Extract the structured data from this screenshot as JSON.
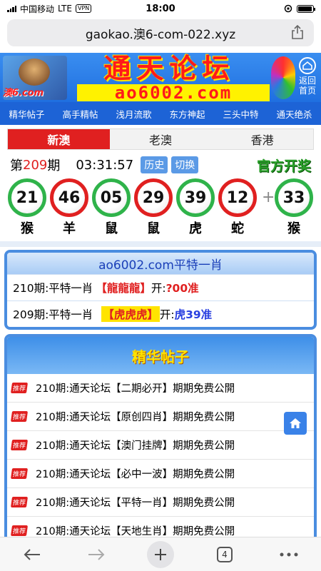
{
  "status": {
    "carrier": "中国移动",
    "network": "LTE",
    "vpn": "VPN",
    "time": "18:00",
    "battery_level": 0.95
  },
  "url": "gaokao.澳6-com-022.xyz",
  "banner": {
    "left_domain": "澳6.com",
    "title": "通天论坛",
    "subtitle": "ao6002.com",
    "back_label": "返回首页"
  },
  "nav": [
    "精华帖子",
    "高手精帖",
    "浅月流歌",
    "东方神起",
    "三头中特",
    "通天绝杀"
  ],
  "tabs": [
    {
      "label": "新澳",
      "active": true
    },
    {
      "label": "老澳",
      "active": false
    },
    {
      "label": "香港",
      "active": false
    }
  ],
  "draw": {
    "prefix": "第",
    "issue": "209",
    "suffix": "期",
    "countdown": "03:31:57",
    "history_label": "历史",
    "switch_label": "切换",
    "official_label": "官方开奖",
    "balls": [
      {
        "num": "21",
        "zodiac": "猴",
        "color": "green"
      },
      {
        "num": "46",
        "zodiac": "羊",
        "color": "red"
      },
      {
        "num": "05",
        "zodiac": "鼠",
        "color": "green"
      },
      {
        "num": "29",
        "zodiac": "鼠",
        "color": "red"
      },
      {
        "num": "39",
        "zodiac": "虎",
        "color": "green"
      },
      {
        "num": "12",
        "zodiac": "蛇",
        "color": "red"
      }
    ],
    "plus": "+",
    "special": {
      "num": "33",
      "zodiac": "猴",
      "color": "green"
    }
  },
  "special_box": {
    "title": "ao6002.com平特一肖",
    "rows": [
      {
        "prefix": "210期:平特一肖",
        "pick": "【龍龍龍】",
        "open_label": "开:",
        "result": "?00准",
        "highlight": false
      },
      {
        "prefix": "209期:平特一肖",
        "pick": "【虎虎虎】",
        "open_label": "开:",
        "result": "虎39准",
        "highlight": true
      }
    ]
  },
  "featured": {
    "title": "精华帖子",
    "badge": "推荐",
    "posts": [
      "210期:通天论坛【二期必开】期期免费公開",
      "210期:通天论坛【原创四肖】期期免费公開",
      "210期:通天论坛【澳门挂牌】期期免费公開",
      "210期:通天论坛【必中一波】期期免费公開",
      "210期:通天论坛【平特一肖】期期免费公開",
      "210期:通天论坛【天地生肖】期期免费公開"
    ]
  },
  "toolbar": {
    "tab_count": "4"
  },
  "colors": {
    "nav_blue": "#1d63d6",
    "accent_red": "#e02020",
    "green_ball": "#2fb34a",
    "red_ball": "#e02020"
  }
}
